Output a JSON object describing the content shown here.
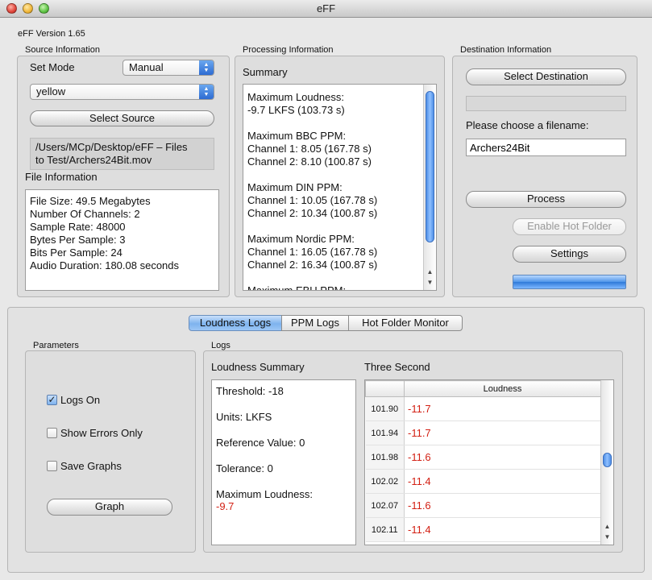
{
  "window": {
    "title": "eFF"
  },
  "version": "eFF Version 1.65",
  "source": {
    "group_label": "Source Information",
    "set_mode_label": "Set Mode",
    "mode_value": "Manual",
    "preset_value": "yellow",
    "select_source_label": "Select Source",
    "path": "/Users/MCp/Desktop/eFF – Files\nto Test/Archers24Bit.mov",
    "file_info_label": "File Information",
    "file_info": "File Size: 49.5 Megabytes\nNumber Of Channels: 2\nSample Rate: 48000\nBytes Per Sample: 3\nBits Per Sample: 24\nAudio Duration: 180.08 seconds"
  },
  "processing": {
    "group_label": "Processing Information",
    "summary_label": "Summary",
    "summary_text": "Maximum Loudness:\n-9.7 LKFS (103.73 s)\n\nMaximum BBC PPM:\nChannel 1: 8.05 (167.78 s)\nChannel 2: 8.10 (100.87 s)\n\nMaximum DIN PPM:\nChannel 1: 10.05 (167.78 s)\nChannel 2: 10.34 (100.87 s)\n\nMaximum Nordic PPM:\nChannel 1: 16.05 (167.78 s)\nChannel 2: 16.34 (100.87 s)\n\nMaximum EBU PPM:"
  },
  "destination": {
    "group_label": "Destination Information",
    "select_destination_label": "Select Destination",
    "filename_prompt": "Please choose a filename:",
    "filename_value": "Archers24Bit",
    "process_label": "Process",
    "hot_folder_label": "Enable Hot Folder",
    "settings_label": "Settings",
    "progress": 1.0
  },
  "tabs": [
    {
      "label": "Loudness Logs",
      "active": true
    },
    {
      "label": "PPM Logs",
      "active": false
    },
    {
      "label": "Hot Folder Monitor",
      "active": false
    }
  ],
  "parameters": {
    "group_label": "Parameters",
    "logs_on": {
      "label": "Logs On",
      "checked": true
    },
    "errors_only": {
      "label": "Show Errors Only",
      "checked": false
    },
    "save_graphs": {
      "label": "Save Graphs",
      "checked": false
    },
    "graph_label": "Graph"
  },
  "logs": {
    "group_label": "Logs",
    "loudness_summary_label": "Loudness Summary",
    "three_second_label": "Three Second",
    "summary_threshold": "Threshold: -18",
    "summary_units": "Units: LKFS",
    "summary_reference": "Reference Value: 0",
    "summary_tolerance": "Tolerance: 0",
    "summary_max_label": "Maximum Loudness:",
    "summary_max_value": "-9.7",
    "table_header": "Loudness",
    "rows": [
      {
        "time": "101.90",
        "value": "-11.7"
      },
      {
        "time": "101.94",
        "value": "-11.7"
      },
      {
        "time": "101.98",
        "value": "-11.6"
      },
      {
        "time": "102.02",
        "value": "-11.4"
      },
      {
        "time": "102.07",
        "value": "-11.6"
      },
      {
        "time": "102.11",
        "value": "-11.4"
      }
    ]
  },
  "colors": {
    "accent": "#4f8fe6",
    "warning_text": "#d32014"
  }
}
